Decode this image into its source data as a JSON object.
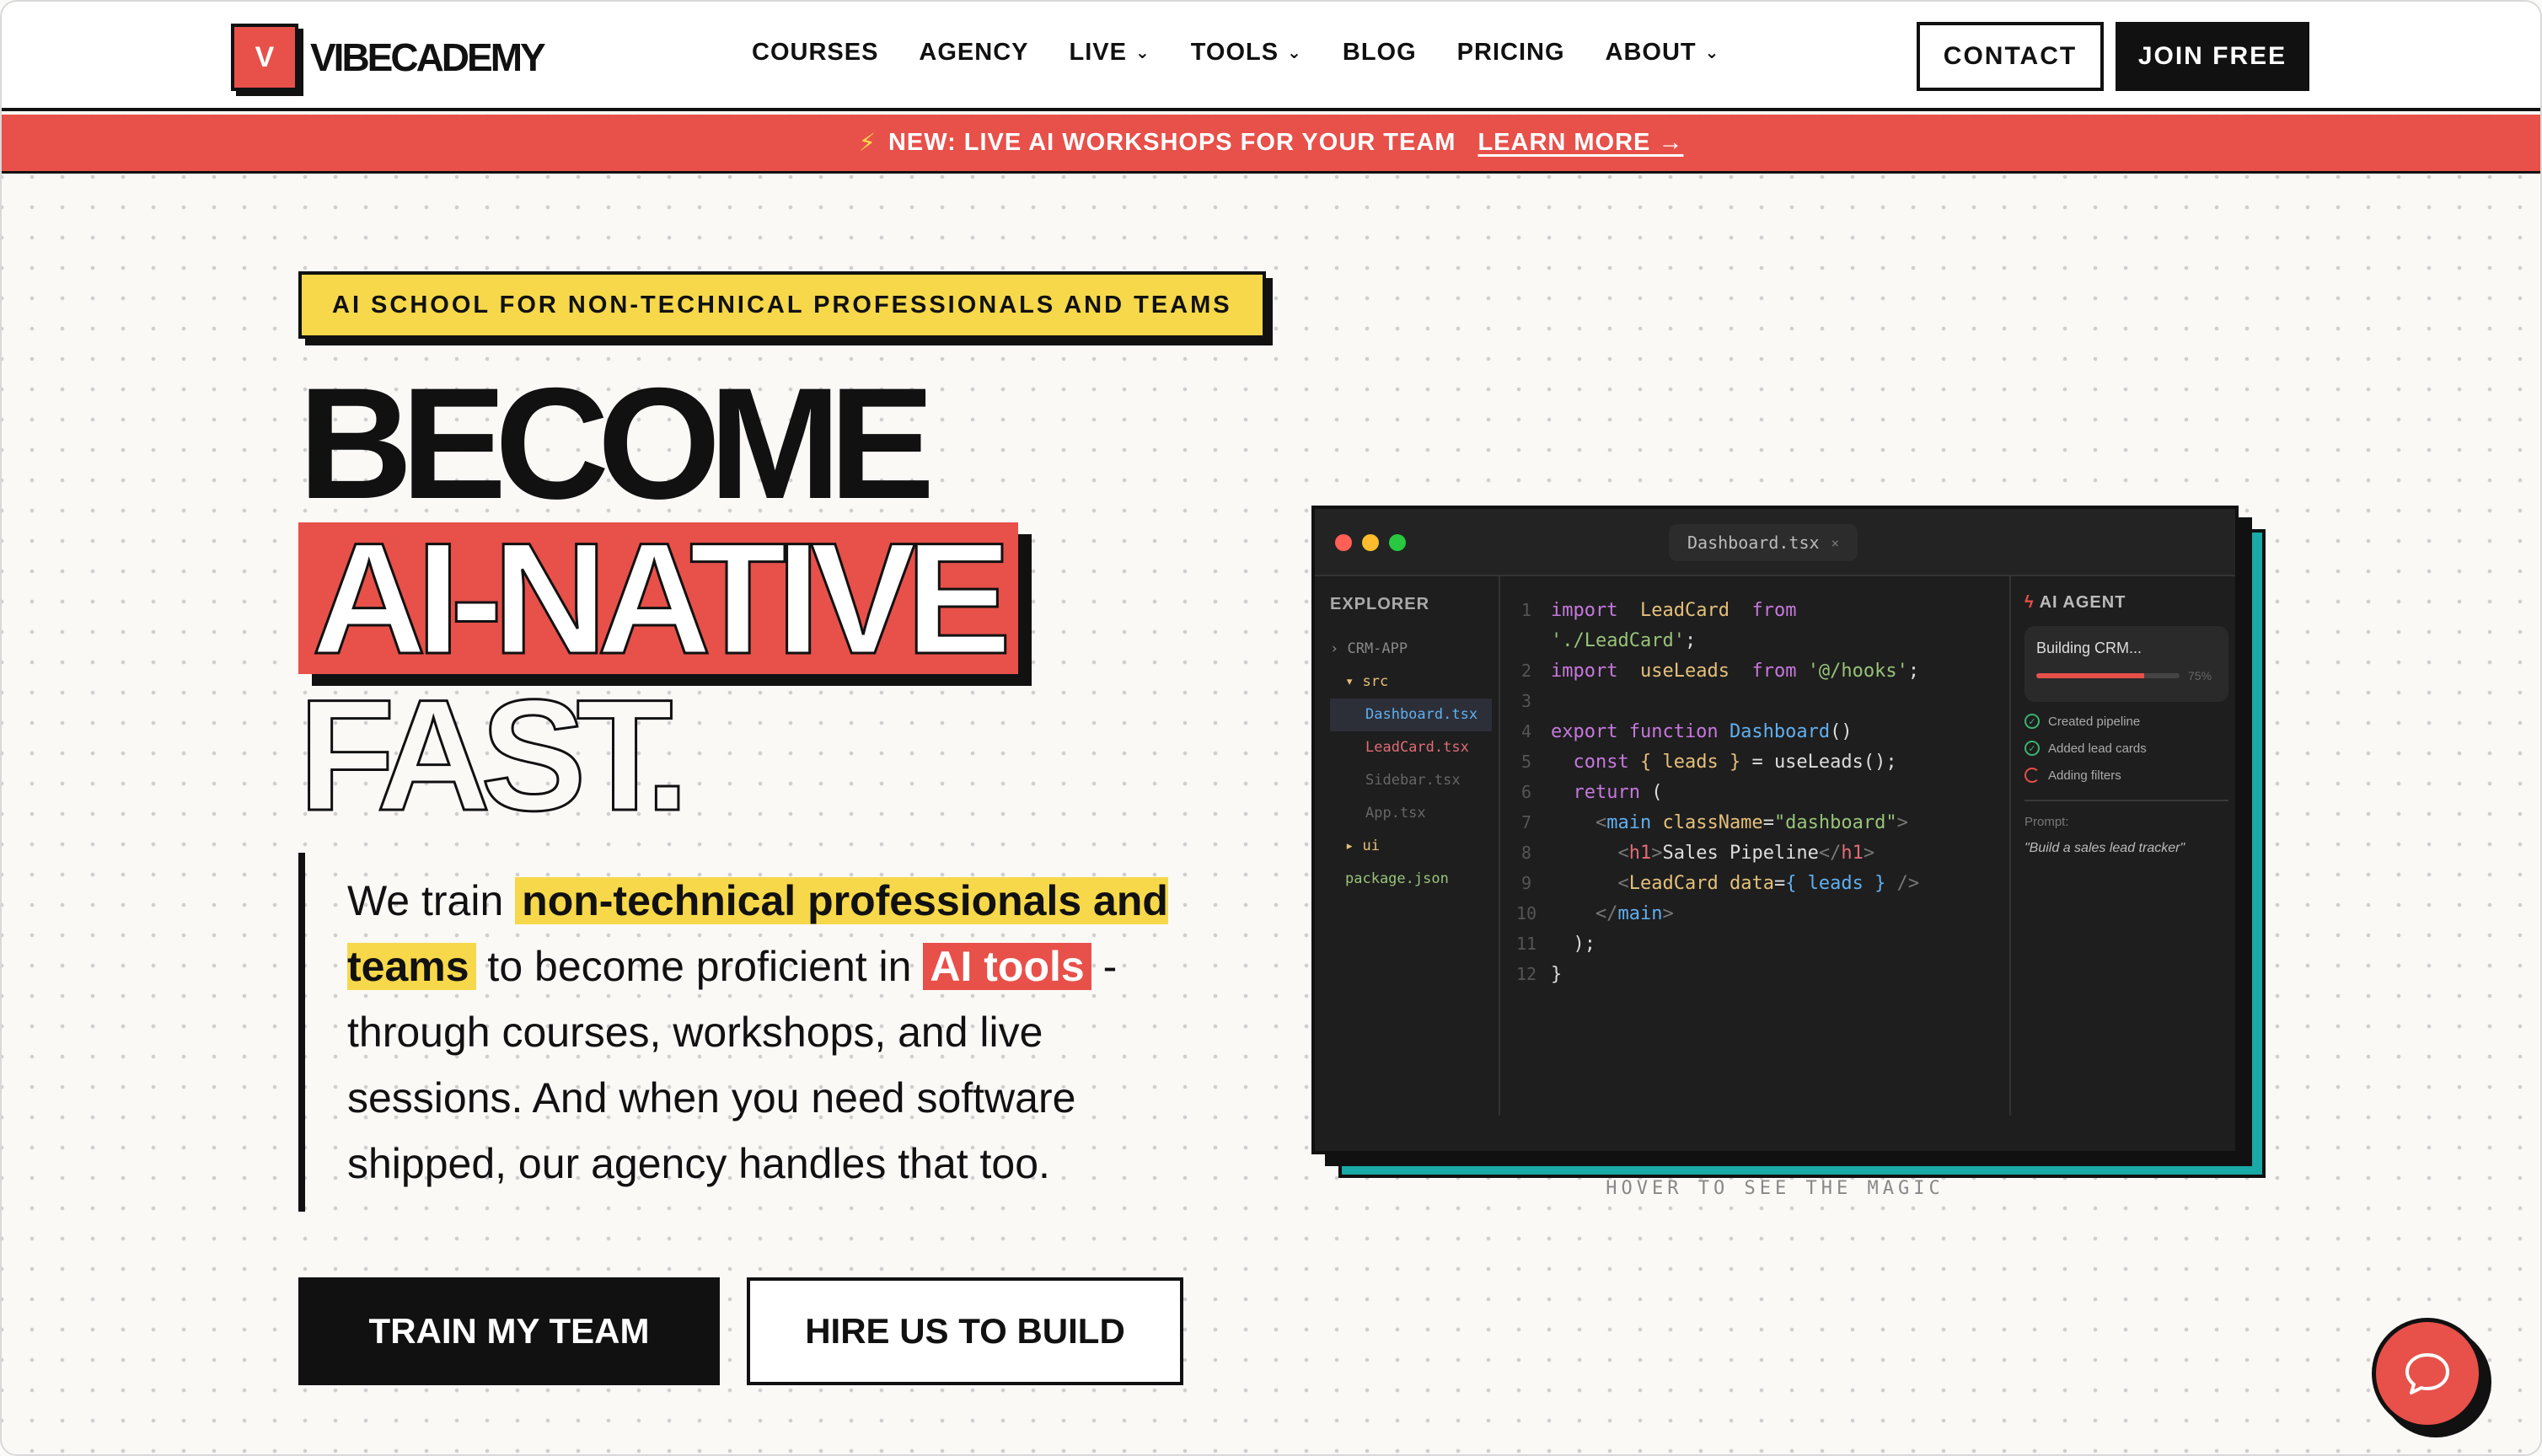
{
  "brand": {
    "logo_letter": "V",
    "name": "VIBECADEMY",
    "accent": "#e8504a",
    "highlight": "#f6d84a",
    "teal": "#19a9a7"
  },
  "nav": {
    "items": [
      {
        "label": "COURSES",
        "has_dropdown": false
      },
      {
        "label": "AGENCY",
        "has_dropdown": false
      },
      {
        "label": "LIVE",
        "has_dropdown": true
      },
      {
        "label": "TOOLS",
        "has_dropdown": true
      },
      {
        "label": "BLOG",
        "has_dropdown": false
      },
      {
        "label": "PRICING",
        "has_dropdown": false
      },
      {
        "label": "ABOUT",
        "has_dropdown": true
      }
    ],
    "contact": "CONTACT",
    "join": "JOIN FREE"
  },
  "announcement": {
    "icon": "bolt-icon",
    "text": "NEW: LIVE AI WORKSHOPS FOR YOUR TEAM",
    "link": "LEARN MORE →"
  },
  "hero": {
    "tag": "AI SCHOOL FOR NON-TECHNICAL PROFESSIONALS AND TEAMS",
    "line1": "BECOME",
    "line2": "AI-NATIVE",
    "line3": "FAST.",
    "desc_part1": "We train ",
    "desc_hl1": "non-technical professionals and teams",
    "desc_part2": " to become proficient in ",
    "desc_hl2": "AI tools",
    "desc_part3": " - through courses, workshops, and live sessions. And when you need software shipped, our agency handles that too.",
    "cta_primary": "TRAIN MY TEAM",
    "cta_secondary": "HIRE US TO BUILD"
  },
  "editor": {
    "tab": "Dashboard.tsx",
    "explorer_title": "EXPLORER",
    "files": [
      {
        "label": "› CRM-APP",
        "color": "#888"
      },
      {
        "label": "▾ src",
        "color": "#888"
      },
      {
        "label": "Dashboard.tsx",
        "color": "#61afef"
      },
      {
        "label": "LeadCard.tsx",
        "color": "#e06c75"
      },
      {
        "label": "Sidebar.tsx",
        "color": "#666"
      },
      {
        "label": "App.tsx",
        "color": "#666"
      },
      {
        "label": "▸ ui",
        "color": "#888"
      },
      {
        "label": "package.json",
        "color": "#98c379"
      }
    ],
    "code_lines": [
      "1",
      "",
      "2",
      "3",
      "4",
      "5",
      "6",
      "7",
      "8",
      "9",
      "10",
      "11",
      "12"
    ],
    "agent": {
      "title": "AI AGENT",
      "status": "Building CRM...",
      "progress": 75,
      "progress_label": "75%",
      "steps": [
        {
          "label": "Created pipeline",
          "done": true
        },
        {
          "label": "Added lead cards",
          "done": true
        },
        {
          "label": "Adding filters",
          "done": false
        }
      ],
      "prompt_label": "Prompt:",
      "prompt": "\"Build a sales lead tracker\""
    },
    "hint": "HOVER TO SEE THE MAGIC"
  },
  "chat": {
    "icon": "chat-bubble-icon"
  }
}
